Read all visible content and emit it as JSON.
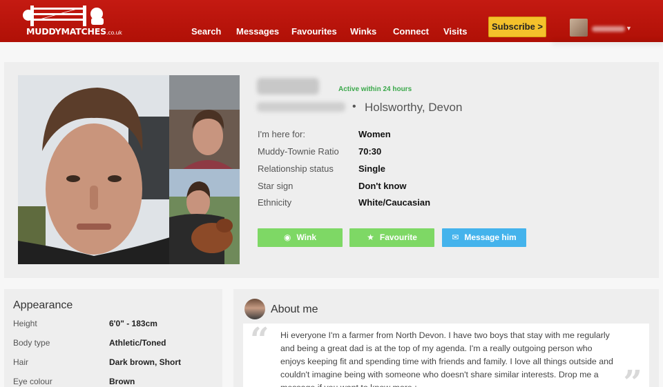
{
  "header": {
    "brand": "MUDDYMATCHES",
    "brand_suffix": ".co.uk",
    "nav": [
      {
        "label": "Search"
      },
      {
        "label": "Messages"
      },
      {
        "label": "Favourites"
      },
      {
        "label": "Winks"
      },
      {
        "label": "Connect"
      },
      {
        "label": "Visits"
      }
    ],
    "subscribe_label": "Subscribe >",
    "colors": {
      "header": "#c41a12",
      "subscribe": "#f4c12b"
    }
  },
  "profile": {
    "status": "Active within 24 hours",
    "separator": "•",
    "location": "Holsworthy, Devon",
    "details": [
      {
        "label": "I'm here for:",
        "value": "Women"
      },
      {
        "label": "Muddy-Townie Ratio",
        "value": "70:30"
      },
      {
        "label": "Relationship status",
        "value": "Single"
      },
      {
        "label": "Star sign",
        "value": "Don't know"
      },
      {
        "label": "Ethnicity",
        "value": "White/Caucasian"
      }
    ],
    "actions": {
      "wink": "Wink",
      "favourite": "Favourite",
      "message": "Message him"
    },
    "colors": {
      "wink": "#7ed865",
      "favourite": "#7ed865",
      "message": "#44b3ec",
      "active": "#3aa84a"
    }
  },
  "appearance": {
    "title": "Appearance",
    "rows": [
      {
        "label": "Height",
        "value": "6'0\" - 183cm"
      },
      {
        "label": "Body type",
        "value": "Athletic/Toned"
      },
      {
        "label": "Hair",
        "value": "Dark brown, Short"
      },
      {
        "label": "Eye colour",
        "value": "Brown"
      }
    ]
  },
  "about": {
    "title": "About me",
    "text": "Hi everyone I'm a farmer from North Devon. I have two boys that stay with me regularly and being a great dad is at the top of my agenda. I'm a really outgoing person who enjoys keeping fit and spending time with friends and family. I love all things outside and couldn't imagine being with someone who doesn't share similar interests. Drop me a message if you want to know more ;"
  }
}
